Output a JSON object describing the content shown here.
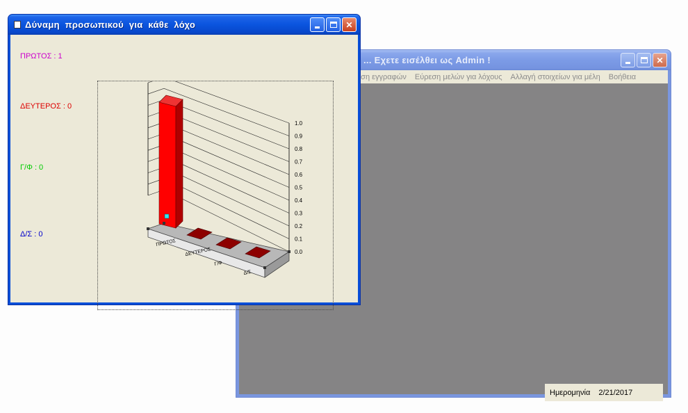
{
  "admin_window": {
    "title": "... Εχετε εισέλθει ως Admin !",
    "menu": [
      "...ση εγγραφών",
      "Εύρεση μελών για λόχους",
      "Αλλαγή στοιχείων για μέλη",
      "Βοήθεια"
    ],
    "date_label": "Ημερομηνία",
    "date_value": "2/21/2017"
  },
  "chart_window": {
    "title": "Δύναμη  προσωπικού  για  κάθε  λόχο",
    "counts": [
      {
        "label": "ΠΡΩΤΟΣ : 1",
        "color": "#cc00cc"
      },
      {
        "label": "ΔΕΥΤΕΡΟΣ : 0",
        "color": "#dd0000"
      },
      {
        "label": "Γ/Φ : 0",
        "color": "#00cc00"
      },
      {
        "label": "Δ/Σ : 0",
        "color": "#0000cc"
      }
    ]
  },
  "chart_data": {
    "type": "bar",
    "categories": [
      "ΠΡΩΤΟΣ",
      "ΔΕΥΤΕΡΟΣ",
      "Γ/Φ",
      "Δ/Σ"
    ],
    "values": [
      1,
      0,
      0,
      0
    ],
    "right_axis_ticks": [
      "1.0",
      "0.9",
      "0.8",
      "0.7",
      "0.6",
      "0.5",
      "0.4",
      "0.3",
      "0.2",
      "0.1",
      "0.0"
    ],
    "ylim": [
      0,
      1
    ],
    "bar_color": "#ff0000",
    "grid": true
  }
}
